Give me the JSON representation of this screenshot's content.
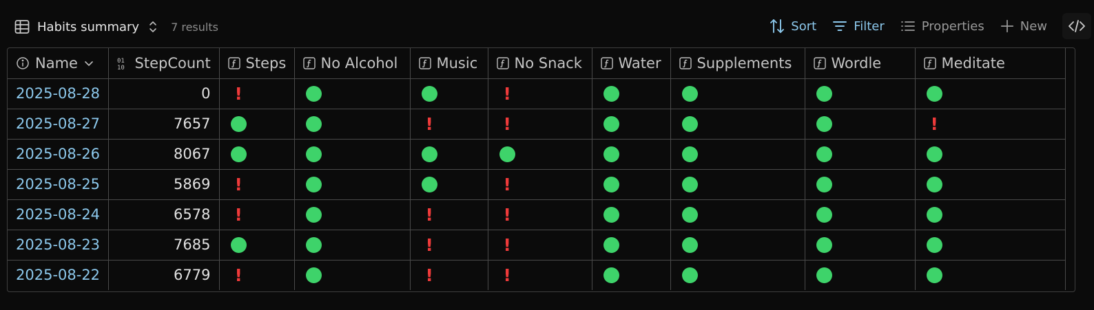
{
  "toolbar": {
    "view_title": "Habits summary",
    "results": "7 results",
    "sort_label": "Sort",
    "filter_label": "Filter",
    "properties_label": "Properties",
    "new_label": "New",
    "accent_color": "#8cc8ec"
  },
  "columns": [
    "Name",
    "StepCount",
    "Steps",
    "No Alcohol",
    "Music",
    "No Snack",
    "Water",
    "Supplements",
    "Wordle",
    "Meditate"
  ],
  "status_legend": {
    "done": "green-circle",
    "missed": "red-exclamation"
  },
  "rows": [
    {
      "name": "2025-08-28",
      "stepcount": "0",
      "statuses": [
        "missed",
        "done",
        "done",
        "missed",
        "done",
        "done",
        "done",
        "done"
      ]
    },
    {
      "name": "2025-08-27",
      "stepcount": "7657",
      "statuses": [
        "done",
        "done",
        "missed",
        "missed",
        "done",
        "done",
        "done",
        "missed"
      ]
    },
    {
      "name": "2025-08-26",
      "stepcount": "8067",
      "statuses": [
        "done",
        "done",
        "done",
        "done",
        "done",
        "done",
        "done",
        "done"
      ]
    },
    {
      "name": "2025-08-25",
      "stepcount": "5869",
      "statuses": [
        "missed",
        "done",
        "done",
        "missed",
        "done",
        "done",
        "done",
        "done"
      ]
    },
    {
      "name": "2025-08-24",
      "stepcount": "6578",
      "statuses": [
        "missed",
        "done",
        "missed",
        "missed",
        "done",
        "done",
        "done",
        "done"
      ]
    },
    {
      "name": "2025-08-23",
      "stepcount": "7685",
      "statuses": [
        "done",
        "done",
        "missed",
        "missed",
        "done",
        "done",
        "done",
        "done"
      ]
    },
    {
      "name": "2025-08-22",
      "stepcount": "6779",
      "statuses": [
        "missed",
        "done",
        "missed",
        "missed",
        "done",
        "done",
        "done",
        "done"
      ]
    }
  ]
}
